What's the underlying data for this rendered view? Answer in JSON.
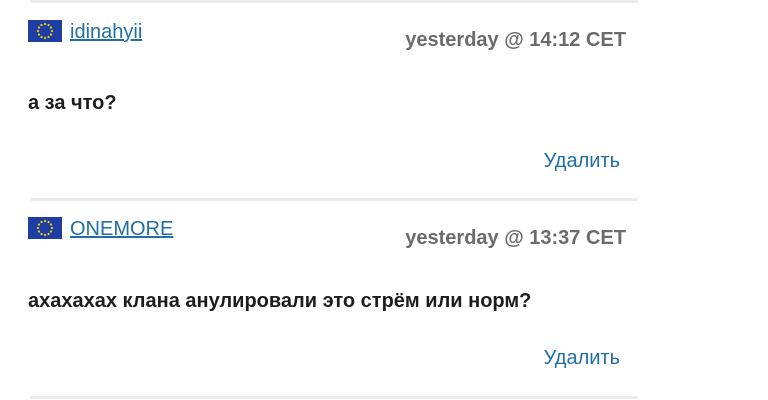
{
  "comments": [
    {
      "username": "idinahyii",
      "timestamp": "yesterday @ 14:12 CET",
      "text": "а за что?",
      "delete_label": "Удалить",
      "flag_icon": "eu-flag-icon"
    },
    {
      "username": "ONEMORE",
      "timestamp": "yesterday @ 13:37 CET",
      "text": "ахахахах клана анулировали это стрём или норм?",
      "delete_label": "Удалить",
      "flag_icon": "eu-flag-icon"
    }
  ],
  "colors": {
    "link": "#1f6fa6",
    "timestamp": "#6b6b6b",
    "text": "#1d1d1d",
    "divider": "#ececec",
    "flag_blue": "#1f3ea3",
    "flag_star": "#f5d000"
  }
}
